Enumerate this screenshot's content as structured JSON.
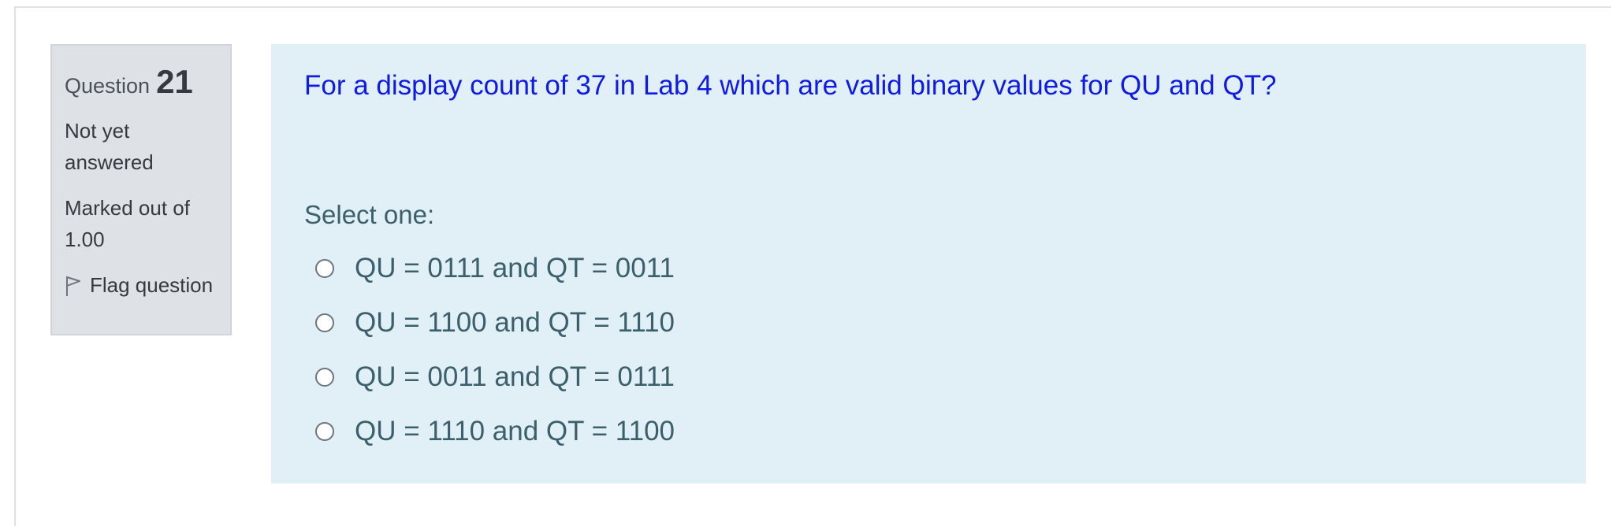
{
  "question_info": {
    "label": "Question",
    "number": "21",
    "state": "Not yet answered",
    "grade": "Marked out of 1.00",
    "flag_label": "Flag question"
  },
  "question": {
    "text": "For a display count of 37 in Lab 4 which are valid binary values for QU and QT?",
    "prompt": "Select one:",
    "answers": [
      "QU = 0111 and QT = 0011",
      "QU = 1100 and QT = 1110",
      "QU = 0011 and QT = 0111",
      "QU = 1110 and QT = 1100"
    ]
  },
  "colors": {
    "info_background": "#dee2e6",
    "content_background": "#e1f0f7",
    "question_text": "#0f1ae6",
    "answer_text": "#3b5f6b"
  },
  "icons": {
    "flag": "flag-outline-icon"
  }
}
